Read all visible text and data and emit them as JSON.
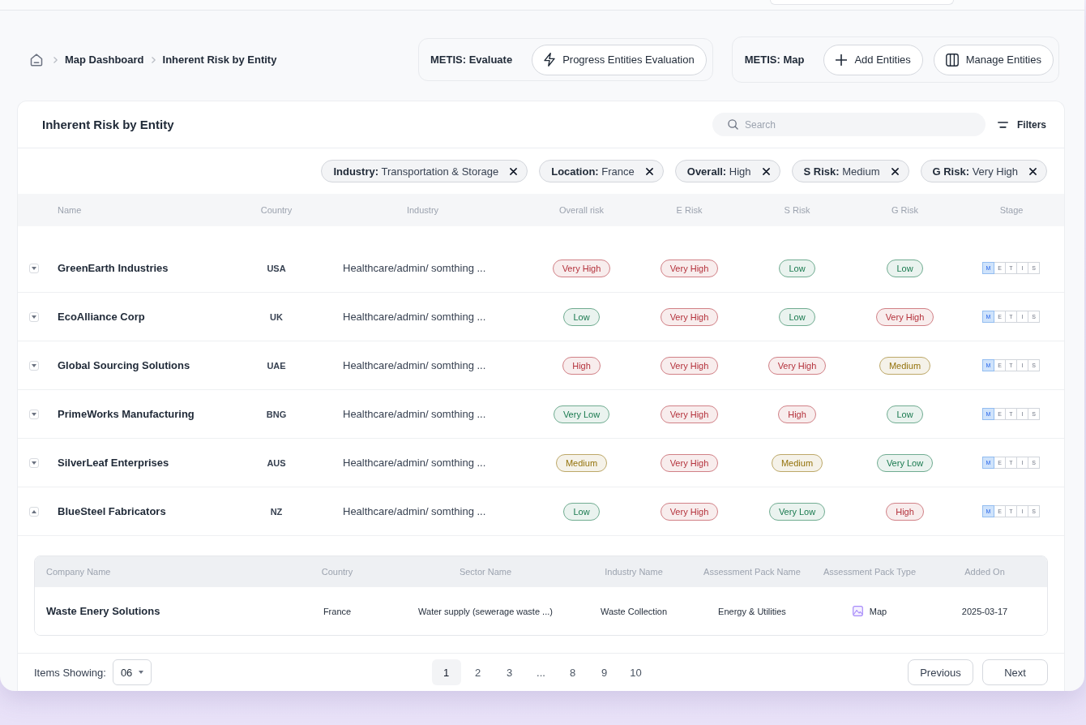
{
  "breadcrumb": [
    {
      "label": "Map Dashboard"
    },
    {
      "label": "Inherent Risk by Entity"
    }
  ],
  "action_groups": [
    {
      "label": "METIS: Evaluate",
      "buttons": [
        {
          "kind": "progress",
          "label": "Progress Entities Evaluation"
        }
      ]
    },
    {
      "label": "METIS: Map",
      "buttons": [
        {
          "kind": "add",
          "label": "Add Entities"
        },
        {
          "kind": "manage",
          "label": "Manage Entities"
        }
      ]
    }
  ],
  "panel": {
    "title": "Inherent Risk by Entity",
    "search": {
      "placeholder": "Search"
    },
    "filters_button": "Filters",
    "chips": [
      "**Industry:** Transportation & Storage",
      "**Location:** France",
      "**Overall:** High",
      "**S Risk:** Medium",
      "**G Risk:** Very High"
    ]
  },
  "table": {
    "columns": [
      "Name",
      "Country",
      "Industry",
      "Overall risk",
      "E Risk",
      "S Risk",
      "G Risk",
      "Stage"
    ],
    "rows": [
      {
        "expanded": false,
        "name": "GreenEarth Industries",
        "country": "USA",
        "industry": "Healthcare/admin/ somthing ...",
        "risks": [
          {
            "label": "Very High",
            "color": "#b4323c"
          },
          {
            "label": "Very High",
            "color": "#b4323c"
          },
          {
            "label": "Low",
            "color": "#18794e"
          },
          {
            "label": "Low",
            "color": "#18794e"
          }
        ],
        "stage": [
          {
            "label": "M",
            "active": true
          },
          {
            "label": "E",
            "active": false
          },
          {
            "label": "T",
            "active": false
          },
          {
            "label": "I",
            "active": false
          },
          {
            "label": "S",
            "active": false
          }
        ]
      },
      {
        "expanded": false,
        "name": "EcoAlliance Corp",
        "country": "UK",
        "industry": "Healthcare/admin/ somthing ...",
        "risks": [
          {
            "label": "Low",
            "color": "#18794e"
          },
          {
            "label": "Very High",
            "color": "#b4323c"
          },
          {
            "label": "Low",
            "color": "#18794e"
          },
          {
            "label": "Very High",
            "color": "#b4323c"
          }
        ],
        "stage": [
          {
            "label": "M",
            "active": true
          },
          {
            "label": "E",
            "active": false
          },
          {
            "label": "T",
            "active": false
          },
          {
            "label": "I",
            "active": false
          },
          {
            "label": "S",
            "active": false
          }
        ]
      },
      {
        "expanded": false,
        "name": "Global Sourcing Solutions",
        "country": "UAE",
        "industry": "Healthcare/admin/ somthing ...",
        "risks": [
          {
            "label": "High",
            "color": "#b4323c"
          },
          {
            "label": "Very High",
            "color": "#b4323c"
          },
          {
            "label": "Very High",
            "color": "#b4323c"
          },
          {
            "label": "Medium",
            "color": "#94730c"
          }
        ],
        "stage": [
          {
            "label": "M",
            "active": true
          },
          {
            "label": "E",
            "active": false
          },
          {
            "label": "T",
            "active": false
          },
          {
            "label": "I",
            "active": false
          },
          {
            "label": "S",
            "active": false
          }
        ]
      },
      {
        "expanded": false,
        "name": "PrimeWorks Manufacturing",
        "country": "BNG",
        "industry": "Healthcare/admin/ somthing ...",
        "risks": [
          {
            "label": "Very Low",
            "color": "#18794e"
          },
          {
            "label": "Very High",
            "color": "#b4323c"
          },
          {
            "label": "High",
            "color": "#b4323c"
          },
          {
            "label": "Low",
            "color": "#18794e"
          }
        ],
        "stage": [
          {
            "label": "M",
            "active": true
          },
          {
            "label": "E",
            "active": false
          },
          {
            "label": "T",
            "active": false
          },
          {
            "label": "I",
            "active": false
          },
          {
            "label": "S",
            "active": false
          }
        ]
      },
      {
        "expanded": false,
        "name": "SilverLeaf Enterprises",
        "country": "AUS",
        "industry": "Healthcare/admin/ somthing ...",
        "risks": [
          {
            "label": "Medium",
            "color": "#94730c"
          },
          {
            "label": "Very High",
            "color": "#b4323c"
          },
          {
            "label": "Medium",
            "color": "#94730c"
          },
          {
            "label": "Very Low",
            "color": "#18794e"
          }
        ],
        "stage": [
          {
            "label": "M",
            "active": true
          },
          {
            "label": "E",
            "active": false
          },
          {
            "label": "T",
            "active": false
          },
          {
            "label": "I",
            "active": false
          },
          {
            "label": "S",
            "active": false
          }
        ]
      },
      {
        "expanded": true,
        "name": "BlueSteel Fabricators",
        "country": "NZ",
        "industry": "Healthcare/admin/ somthing ...",
        "risks": [
          {
            "label": "Low",
            "color": "#18794e"
          },
          {
            "label": "Very High",
            "color": "#b4323c"
          },
          {
            "label": "Very Low",
            "color": "#18794e"
          },
          {
            "label": "High",
            "color": "#b4323c"
          }
        ],
        "stage": [
          {
            "label": "M",
            "active": true
          },
          {
            "label": "E",
            "active": false
          },
          {
            "label": "T",
            "active": false
          },
          {
            "label": "I",
            "active": false
          },
          {
            "label": "S",
            "active": false
          }
        ],
        "detail": {
          "columns": [
            "Company Name",
            "Country",
            "Sector Name",
            "Industry Name",
            "Assessment Pack Name",
            "Assessment Pack Type",
            "Added On"
          ],
          "rows": [
            {
              "company": "Waste Enery Solutions",
              "country": "France",
              "sector": "Water supply (sewerage waste ...)",
              "industry": "Waste Collection",
              "pack_name": "Energy & Utilities",
              "pack_type": "Map",
              "added_on": "2025-03-17"
            }
          ]
        }
      }
    ]
  },
  "footer": {
    "items_label": "Items Showing:",
    "page_size": "06",
    "pages": [
      {
        "label": "1",
        "selected": true
      },
      {
        "label": "2",
        "selected": false
      },
      {
        "label": "3",
        "selected": false
      },
      {
        "label": "...",
        "selected": false
      },
      {
        "label": "8",
        "selected": false
      },
      {
        "label": "9",
        "selected": false
      },
      {
        "label": "10",
        "selected": false
      }
    ],
    "previous": "Previous",
    "next": "Next"
  }
}
